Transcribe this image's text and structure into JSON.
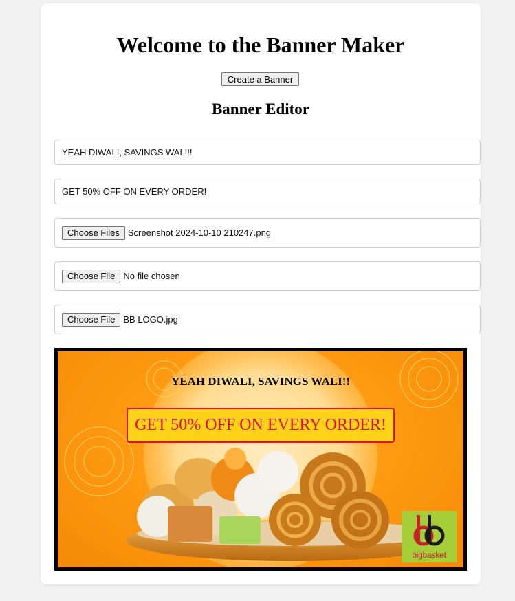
{
  "page": {
    "title": "Welcome to the Banner Maker",
    "create_button_label": "Create a Banner",
    "editor_title": "Banner Editor"
  },
  "editor": {
    "heading_value": "YEAH DIWALI, SAVINGS WALI!!",
    "offer_value": "GET 50% OFF ON EVERY ORDER!",
    "background_file": {
      "button_label": "Choose Files",
      "file_name": "Screenshot 2024-10-10 210247.png"
    },
    "image_file": {
      "button_label": "Choose File",
      "file_name": "No file chosen"
    },
    "logo_file": {
      "button_label": "Choose File",
      "file_name": "BB LOGO.jpg"
    }
  },
  "banner": {
    "heading": "YEAH DIWALI, SAVINGS WALI!!",
    "offer": "GET 50% OFF ON EVERY ORDER!",
    "logo_text": "bigbasket"
  },
  "colors": {
    "banner_orange": "#ff9a12",
    "offer_box_fill": "#ffd21a",
    "offer_text": "#e0102a",
    "logo_green": "#a6ce39",
    "logo_red": "#c41f2a"
  },
  "icons": {
    "logo": "bigbasket-logo",
    "decor": "mandala-decor"
  }
}
